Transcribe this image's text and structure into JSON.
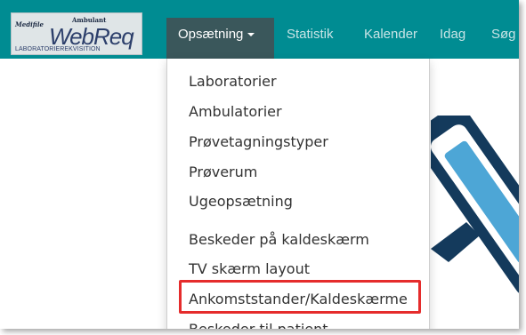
{
  "brand": {
    "top_left": "Medifile",
    "top_right": "Ambulant",
    "name": "WebReq",
    "subtitle": "LABORATORIEREKVISITION"
  },
  "nav": {
    "active_label": "Opsætning",
    "items": [
      "Statistik",
      "Kalender",
      "Idag",
      "Søg"
    ]
  },
  "menu": {
    "items": [
      "Laboratorier",
      "Ambulatorier",
      "Prøvetagningstyper",
      "Prøverum",
      "Ugeopsætning",
      "Beskeder på kaldeskærm",
      "TV skærm layout",
      "Ankomststander/Kaldeskærme",
      "Beskeder til patient"
    ]
  },
  "colors": {
    "navbar": "#008c92",
    "active_tab": "#3a575b",
    "highlight_border": "#e52c2c",
    "logo_dark": "#143a5c",
    "logo_light": "#4da6d6"
  }
}
